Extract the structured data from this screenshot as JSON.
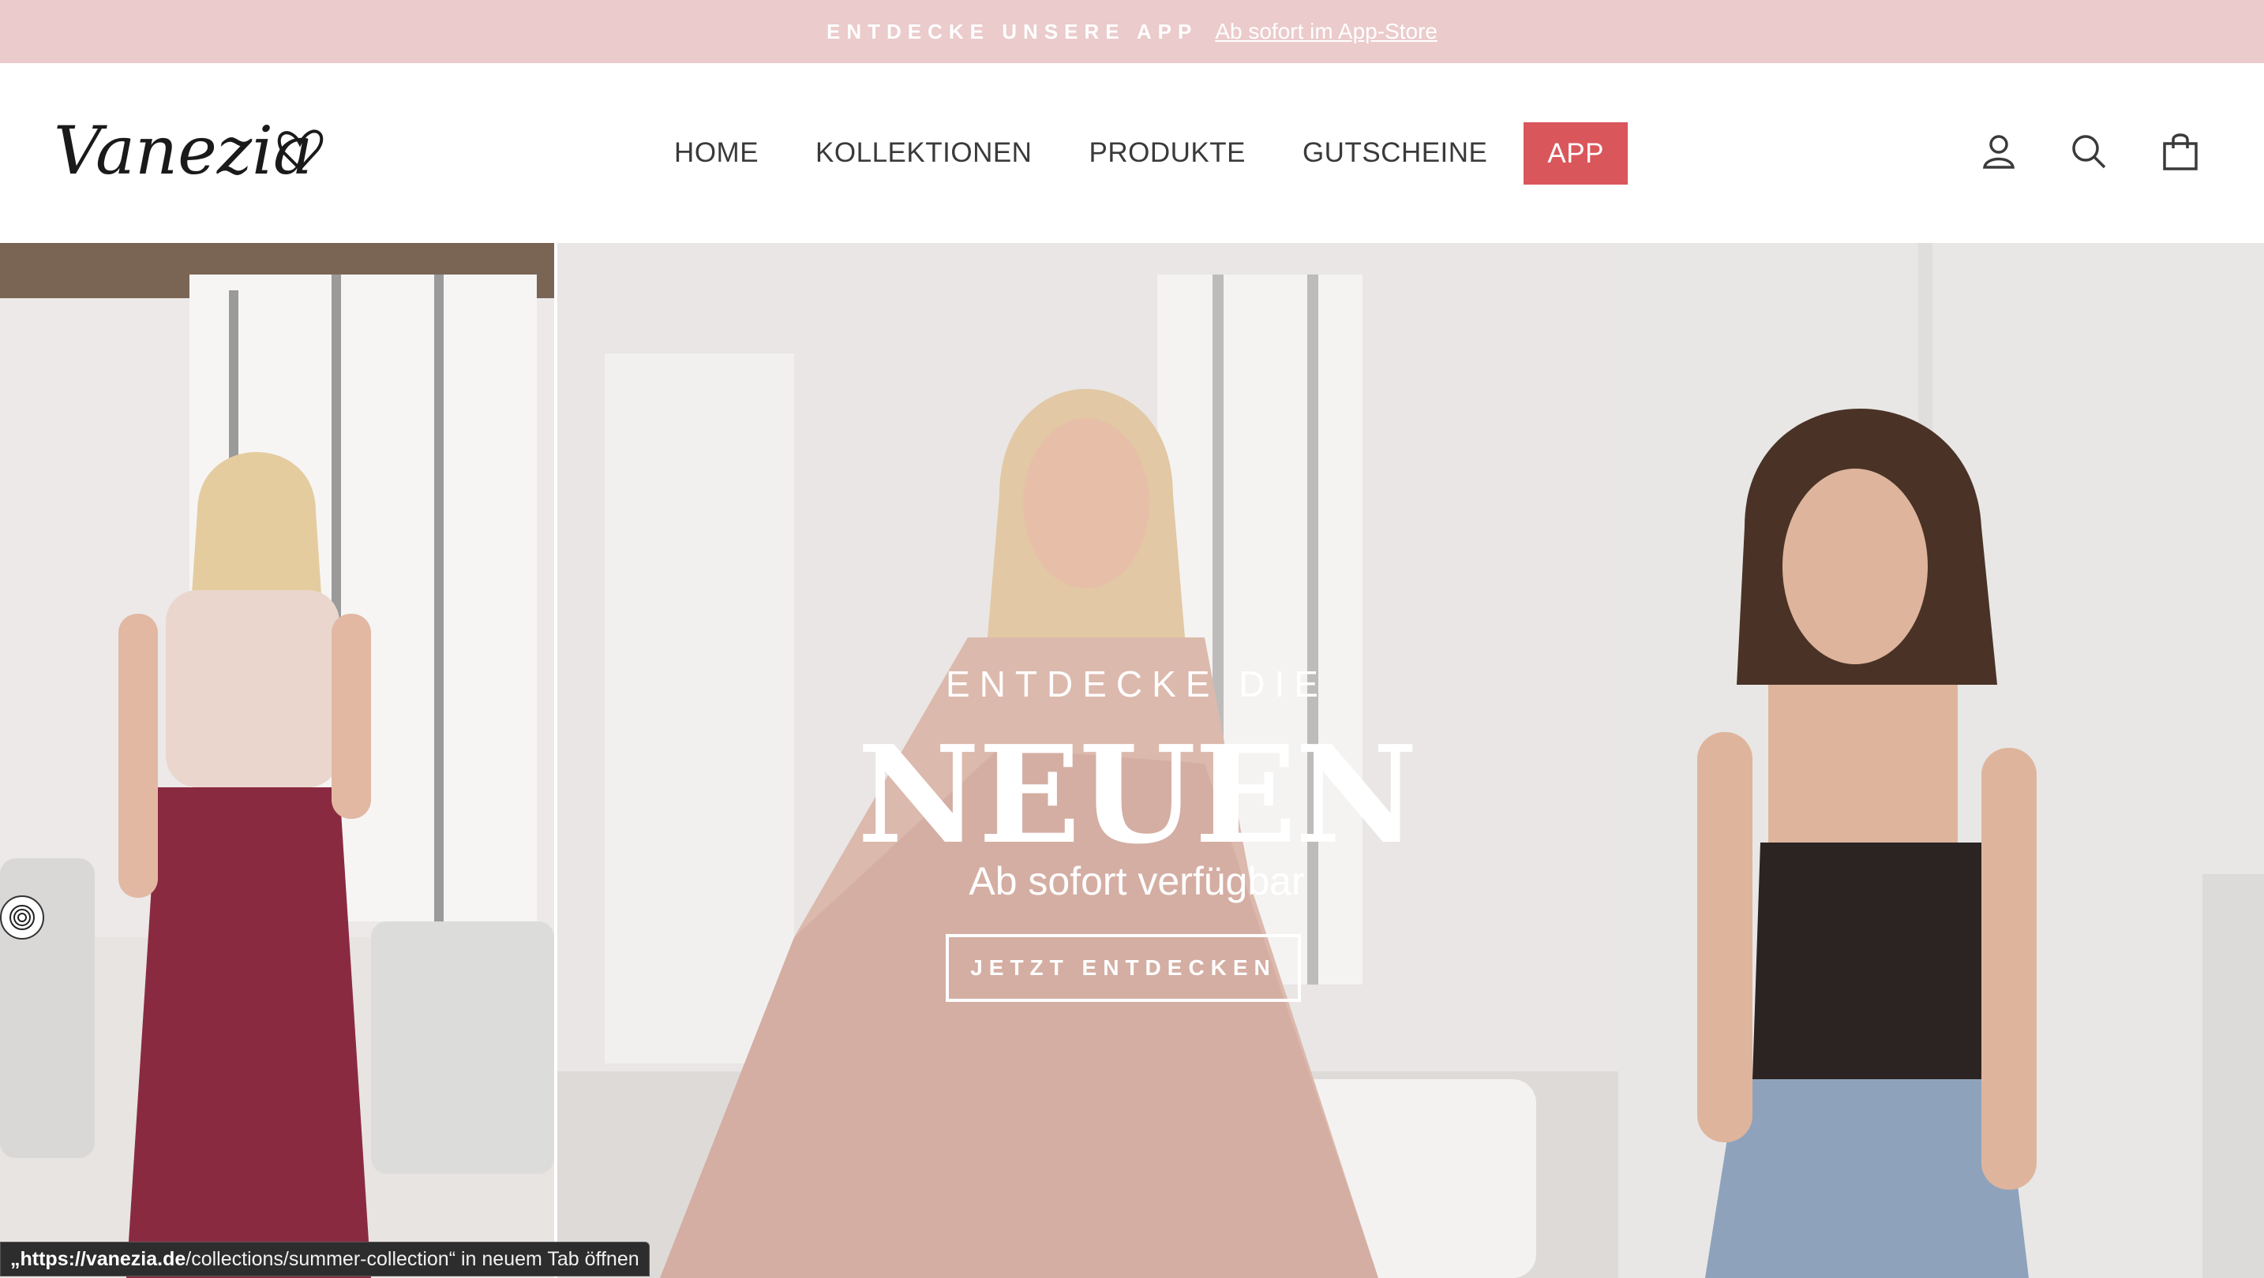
{
  "announcement": {
    "strong": "ENTDECKE UNSERE APP",
    "link": "Ab sofort im App-Store"
  },
  "header": {
    "logo_text": "Vanezia",
    "nav": [
      {
        "label": "HOME"
      },
      {
        "label": "KOLLEKTIONEN"
      },
      {
        "label": "PRODUKTE"
      },
      {
        "label": "GUTSCHEINE"
      },
      {
        "label": "APP"
      }
    ],
    "icons": [
      "account-icon",
      "search-icon",
      "cart-icon"
    ]
  },
  "hero": {
    "kicker": "ENTDECKE DIE",
    "title": "NEUEN",
    "subtitle": "Ab sofort verfügbar",
    "button": "JETZT ENTDECKEN"
  },
  "status_bar": {
    "prefix": "„https://vanezia.de",
    "path": "/collections/summer-collection“ in neuem Tab öffnen"
  },
  "colors": {
    "announcement_bg": "#ebcbcb",
    "app_button_bg": "#d9565b",
    "text": "#3a3a3a"
  }
}
